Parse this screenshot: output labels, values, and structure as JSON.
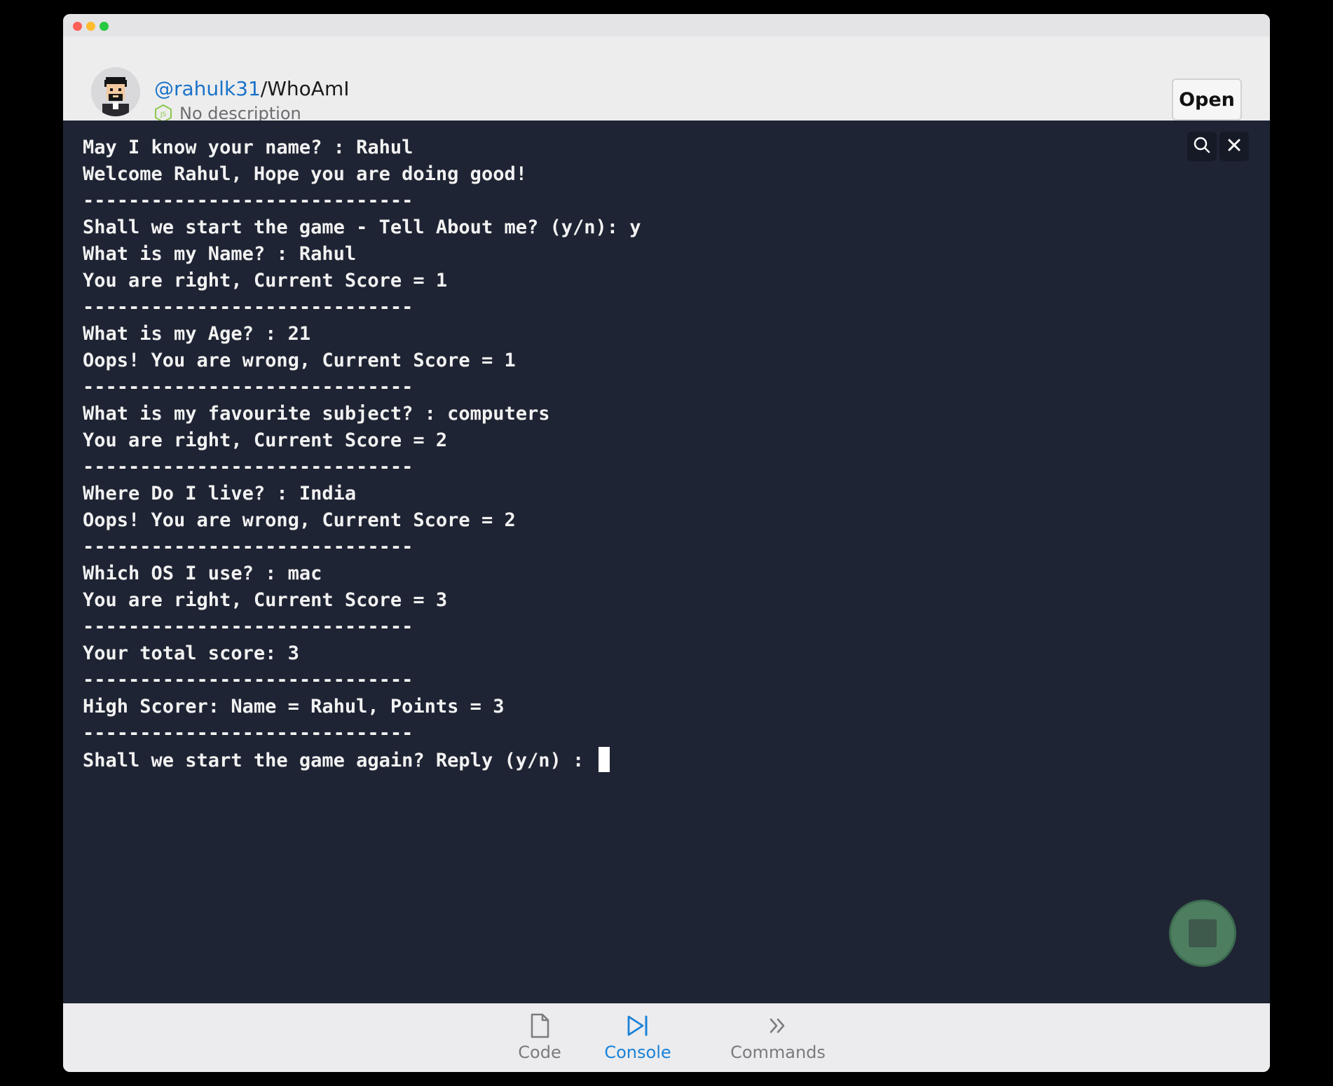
{
  "header": {
    "owner": "@rahulk31",
    "separator": "/",
    "repo": "WhoAmI",
    "description": "No description",
    "open_label": "Open"
  },
  "console": {
    "lines": [
      "May I know your name? : Rahul",
      "Welcome Rahul, Hope you are doing good!",
      "-----------------------------",
      "Shall we start the game - Tell About me? (y/n): y",
      "What is my Name? : Rahul",
      "You are right, Current Score = 1",
      "-----------------------------",
      "What is my Age? : 21",
      "Oops! You are wrong, Current Score = 1",
      "-----------------------------",
      "What is my favourite subject? : computers",
      "You are right, Current Score = 2",
      "-----------------------------",
      "Where Do I live? : India",
      "Oops! You are wrong, Current Score = 2",
      "-----------------------------",
      "Which OS I use? : mac",
      "You are right, Current Score = 3",
      "-----------------------------",
      "Your total score: 3",
      "-----------------------------",
      "High Scorer: Name = Rahul, Points = 3",
      "-----------------------------",
      "Shall we start the game again? Reply (y/n) : "
    ],
    "tools": [
      "search-icon",
      "close-icon"
    ]
  },
  "tabs": [
    {
      "label": "Code",
      "icon": "file-icon",
      "active": false
    },
    {
      "label": "Console",
      "icon": "console-icon",
      "active": true
    },
    {
      "label": "Commands",
      "icon": "chevrons-right-icon",
      "active": false
    }
  ],
  "colors": {
    "console_bg": "#1f2434",
    "accent": "#1a82d8",
    "stop_button": "#4c7e5f"
  }
}
